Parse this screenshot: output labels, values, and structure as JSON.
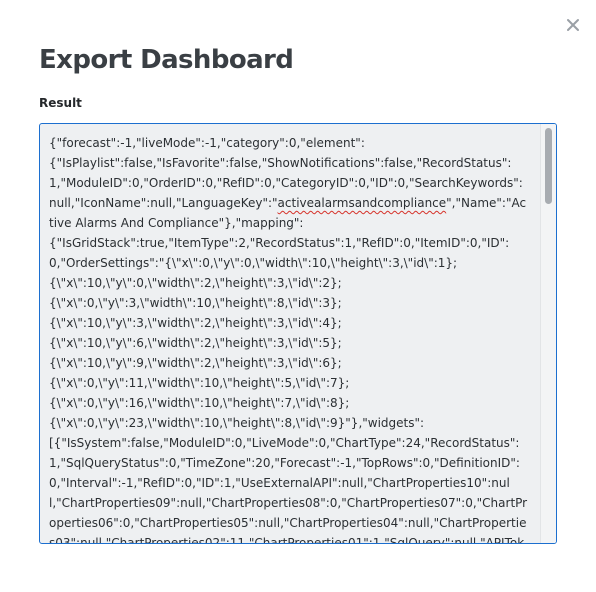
{
  "dialog": {
    "title": "Export Dashboard",
    "close_icon": "close-icon",
    "result_label": "Result"
  },
  "result": {
    "lines": [
      "{\"forecast\":-1,\"liveMode\":-1,\"category\":0,\"element\":",
      "{\"IsPlaylist\":false,\"IsFavorite\":false,\"ShowNotifications\":false,\"RecordStatus\":1,\"ModuleID\":0,\"OrderID\":0,\"RefID\":0,\"CategoryID\":0,\"ID\":0,\"SearchKeywords\":null,\"IconName\":null,\"LanguageKey\":\"",
      "activealarmsandcompliance",
      "\",\"Name\":\"Active Alarms And Compliance\"},\"mapping\":",
      "{\"IsGridStack\":true,\"ItemType\":2,\"RecordStatus\":1,\"RefID\":0,\"ItemID\":0,\"ID\":0,\"OrderSettings\":\"{\\\"x\\\":0,\\\"y\\\":0,\\\"width\\\":10,\\\"height\\\":3,\\\"id\\\":1};",
      "{\\\"x\\\":10,\\\"y\\\":0,\\\"width\\\":2,\\\"height\\\":3,\\\"id\\\":2};",
      "{\\\"x\\\":0,\\\"y\\\":3,\\\"width\\\":10,\\\"height\\\":8,\\\"id\\\":3};",
      "{\\\"x\\\":10,\\\"y\\\":3,\\\"width\\\":2,\\\"height\\\":3,\\\"id\\\":4};",
      "{\\\"x\\\":10,\\\"y\\\":6,\\\"width\\\":2,\\\"height\\\":3,\\\"id\\\":5};",
      "{\\\"x\\\":10,\\\"y\\\":9,\\\"width\\\":2,\\\"height\\\":3,\\\"id\\\":6};",
      "{\\\"x\\\":0,\\\"y\\\":11,\\\"width\\\":10,\\\"height\\\":5,\\\"id\\\":7};",
      "{\\\"x\\\":0,\\\"y\\\":16,\\\"width\\\":10,\\\"height\\\":7,\\\"id\\\":8};",
      "{\\\"x\\\":0,\\\"y\\\":23,\\\"width\\\":10,\\\"height\\\":8,\\\"id\\\":9}\"},\"widgets\":",
      "[{\"IsSystem\":false,\"ModuleID\":0,\"LiveMode\":0,\"ChartType\":24,\"RecordStatus\":1,\"SqlQueryStatus\":0,\"TimeZone\":20,\"Forecast\":-1,\"TopRows\":0,\"DefinitionID\":0,\"Interval\":-1,\"RefID\":0,\"ID\":1,\"UseExternalAPI\":null,\"ChartProperties10\":null,\"ChartProperties09\":null,\"ChartProperties08\":0,\"ChartProperties07\":0,\"ChartProperties06\":0,\"ChartProperties05\":null,\"ChartProperties04\":null,\"ChartProperties03\":null,\"ChartProperties02\":11,\"ChartProperties01\":1,\"SqlQuery\":null,\"APIToken\":null,\"APIUser\":null"
    ]
  }
}
